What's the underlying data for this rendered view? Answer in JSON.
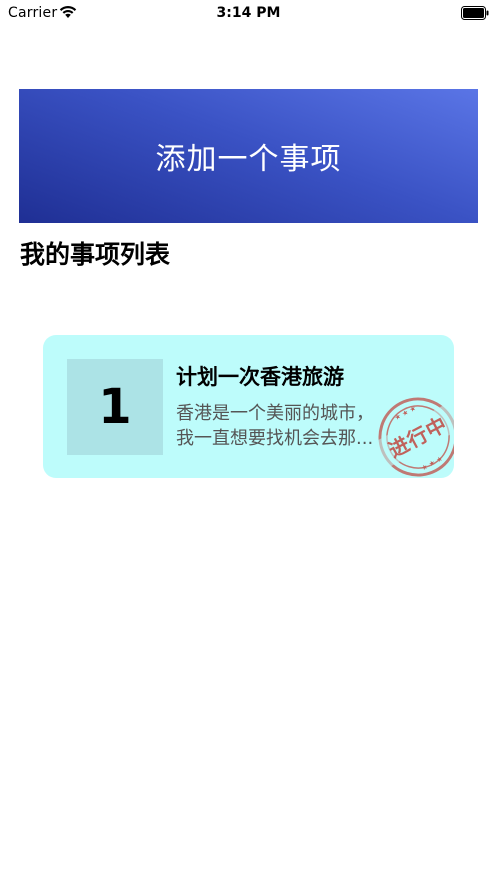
{
  "status_bar": {
    "carrier": "Carrier",
    "time": "3:14 PM",
    "icons": [
      "wifi-icon",
      "battery-icon"
    ]
  },
  "add_button": {
    "label": "添加一个事项",
    "gradient_colors": [
      "#5a75e6",
      "#1f2f94"
    ]
  },
  "section_title": "我的事项列表",
  "tasks": [
    {
      "index": "1",
      "title": "计划一次香港旅游",
      "description": "香港是一个美丽的城市，\n我一直想要找机会去那...",
      "status_stamp": "进行中",
      "card_color": "#bdfcfb",
      "index_box_color": "#ace3e6",
      "stamp_color": "#c0625c"
    }
  ]
}
